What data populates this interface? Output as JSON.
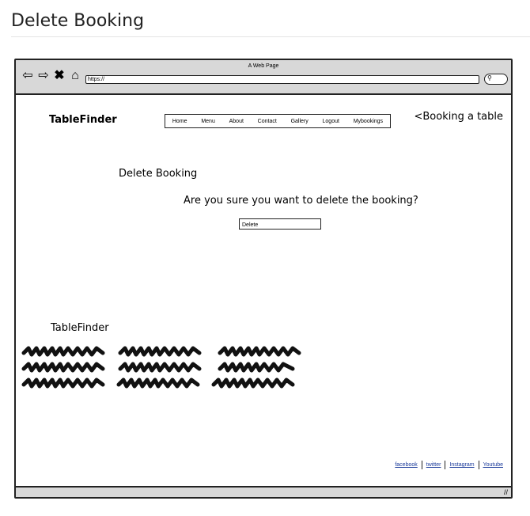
{
  "page": {
    "heading": "Delete Booking"
  },
  "window": {
    "title": "A Web Page",
    "url": "https://"
  },
  "browser_icons": [
    "back-arrow-icon",
    "forward-arrow-icon",
    "close-icon",
    "home-icon",
    "search-icon"
  ],
  "site": {
    "logo": "TableFinder",
    "nav": [
      "Home",
      "Menu",
      "About",
      "Contact",
      "Gallery",
      "Logout",
      "Mybookings"
    ],
    "booking_link": "<Booking a table"
  },
  "main": {
    "title": "Delete Booking",
    "question": "Are you sure you want to delete the booking?",
    "delete_label": "Delete"
  },
  "footer": {
    "logo": "TableFinder",
    "links": [
      "facebook",
      "twitter",
      "Instagram",
      "Youtube"
    ]
  }
}
